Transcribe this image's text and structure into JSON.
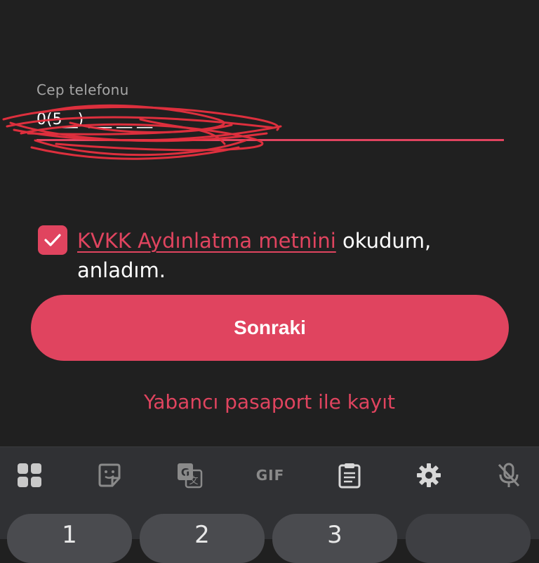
{
  "form": {
    "phone_label": "Cep telefonu",
    "phone_value": "0(5__) ___ __ __"
  },
  "consent": {
    "checked": true,
    "link_text": "KVKK Aydınlatma metnini",
    "text_suffix": " okudum, anladım."
  },
  "actions": {
    "next_label": "Sonraki",
    "foreign_passport_label": "Yabancı pasaport ile kayıt"
  },
  "keyboard": {
    "toolbar_icons": [
      "apps-grid-icon",
      "sticker-icon",
      "translate-icon",
      "gif-icon",
      "clipboard-icon",
      "settings-gear-icon",
      "mic-off-icon"
    ],
    "gif_label": "GIF",
    "keys": [
      "1",
      "2",
      "3",
      ""
    ]
  },
  "colors": {
    "accent": "#e0445f",
    "background": "#202020",
    "keyboard": "#303134"
  }
}
